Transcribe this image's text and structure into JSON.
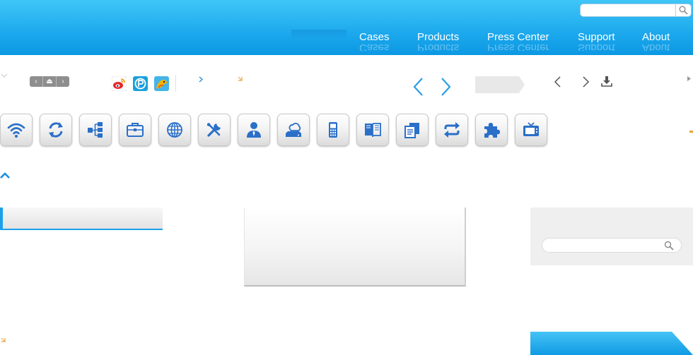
{
  "header": {
    "search_placeholder": "",
    "nav": [
      {
        "label": "Cases"
      },
      {
        "label": "Products"
      },
      {
        "label": "Press Center"
      },
      {
        "label": "Support"
      },
      {
        "label": "About"
      }
    ]
  },
  "toolbar": {
    "mini_controls": [
      "‹",
      "⏏",
      "›"
    ],
    "social": [
      "weibo-icon",
      "p-circle-icon",
      "bird-app-icon"
    ]
  },
  "icon_buttons": [
    "wifi-icon",
    "refresh-icon",
    "sitemap-icon",
    "briefcase-icon",
    "globe-icon",
    "tools-icon",
    "user-icon",
    "cloud-drive-icon",
    "phone-icon",
    "book-icon",
    "copy-icon",
    "sync-icon",
    "puzzle-icon",
    "tv-icon"
  ],
  "side": {
    "search_placeholder": ""
  },
  "colors": {
    "header_top": "#3fc6f7",
    "header_bottom": "#0c98e3",
    "icon_blue": "#2a6fc8",
    "accent": "#1ba1ea"
  }
}
